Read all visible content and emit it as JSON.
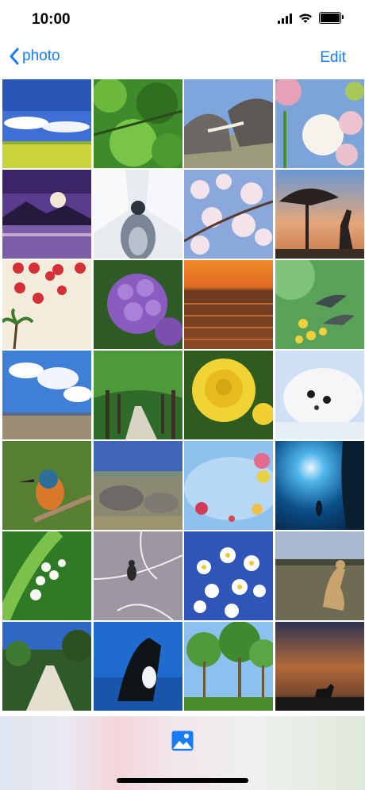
{
  "status_bar": {
    "time": "10:00"
  },
  "nav": {
    "back_label": "photo",
    "edit_label": "Edit"
  },
  "grid": {
    "photos": [
      "meadow-sky",
      "green-leaves",
      "elephants",
      "pink-white-flowers",
      "mountain-sunset",
      "penguin",
      "cherry-blossom",
      "giraffe-silhouette",
      "red-flowers-palm",
      "purple-hydrangea",
      "ocean-sunset",
      "hummingbird",
      "clouds-field",
      "tree-tunnel",
      "yellow-rose",
      "seal-pup",
      "kingfisher",
      "rhinos",
      "hot-air-balloons",
      "underwater-diver",
      "lily-of-valley",
      "bird-on-branch",
      "white-daisies",
      "cheetah",
      "garden-path",
      "orca",
      "green-trees",
      "fox-sunset"
    ]
  },
  "tab_bar": {
    "photo_tab_icon": "photo-icon"
  },
  "colors": {
    "accent": "#1a7cf5"
  }
}
